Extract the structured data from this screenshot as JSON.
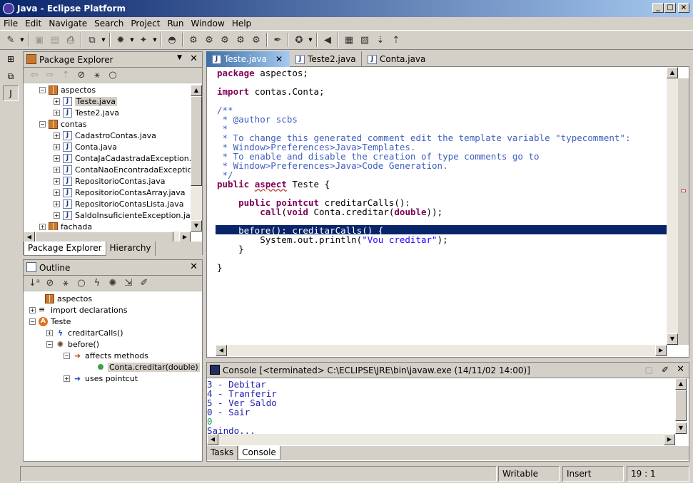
{
  "window": {
    "title": "Java - Eclipse Platform"
  },
  "menu": [
    "File",
    "Edit",
    "Navigate",
    "Search",
    "Project",
    "Run",
    "Window",
    "Help"
  ],
  "package_explorer": {
    "title": "Package Explorer",
    "tree": [
      {
        "label": "aspectos",
        "type": "package",
        "indent": 0,
        "exp": "−"
      },
      {
        "label": "Teste.java",
        "type": "java",
        "indent": 1,
        "exp": "+",
        "selected": true
      },
      {
        "label": "Teste2.java",
        "type": "java",
        "indent": 1,
        "exp": "+"
      },
      {
        "label": "contas",
        "type": "package",
        "indent": 0,
        "exp": "−"
      },
      {
        "label": "CadastroContas.java",
        "type": "java",
        "indent": 1,
        "exp": "+"
      },
      {
        "label": "Conta.java",
        "type": "java",
        "indent": 1,
        "exp": "+"
      },
      {
        "label": "ContaJaCadastradaException.java",
        "type": "java",
        "indent": 1,
        "exp": "+"
      },
      {
        "label": "ContaNaoEncontradaException.java",
        "type": "java",
        "indent": 1,
        "exp": "+"
      },
      {
        "label": "RepositorioContas.java",
        "type": "java",
        "indent": 1,
        "exp": "+"
      },
      {
        "label": "RepositorioContasArray.java",
        "type": "java",
        "indent": 1,
        "exp": "+"
      },
      {
        "label": "RepositorioContasLista.java",
        "type": "java",
        "indent": 1,
        "exp": "+"
      },
      {
        "label": "SaldoInsuficienteException.java",
        "type": "java",
        "indent": 1,
        "exp": "+"
      },
      {
        "label": "fachada",
        "type": "package",
        "indent": 0,
        "exp": "+"
      }
    ],
    "tabs": [
      "Package Explorer",
      "Hierarchy"
    ]
  },
  "outline": {
    "title": "Outline",
    "tree": [
      {
        "label": "aspectos",
        "indent": 0
      },
      {
        "label": "import declarations",
        "indent": 0
      },
      {
        "label": "Teste",
        "indent": 0
      },
      {
        "label": "creditarCalls()",
        "indent": 1
      },
      {
        "label": "before()",
        "indent": 1
      },
      {
        "label": "affects methods",
        "indent": 2
      },
      {
        "label": "Conta.creditar(double)",
        "indent": 3
      },
      {
        "label": "uses pointcut",
        "indent": 2
      }
    ]
  },
  "editor": {
    "tabs": [
      "Teste.java",
      "Teste2.java",
      "Conta.java"
    ],
    "lines": [
      [
        [
          "kw",
          "package"
        ],
        [
          "",
          "aspectos;"
        ]
      ],
      [],
      [
        [
          "kw",
          "import"
        ],
        [
          "",
          "contas.Conta;"
        ]
      ],
      [],
      [
        [
          "cm",
          "/**"
        ]
      ],
      [
        [
          "cm",
          " * @author scbs"
        ]
      ],
      [
        [
          "cm",
          " *"
        ]
      ],
      [
        [
          "cm",
          " * To change this generated comment edit the template variable \"typecomment\":"
        ]
      ],
      [
        [
          "cm",
          " * Window>Preferences>Java>Templates."
        ]
      ],
      [
        [
          "cm",
          " * To enable and disable the creation of type comments go to"
        ]
      ],
      [
        [
          "cm",
          " * Window>Preferences>Java>Code Generation."
        ]
      ],
      [
        [
          "cm",
          " */"
        ]
      ],
      [
        [
          "kw",
          "public"
        ],
        [
          "",
          "."
        ],
        [
          "kw",
          "aspect"
        ],
        [
          "",
          " Teste {"
        ]
      ],
      [],
      [
        [
          "",
          "    "
        ],
        [
          "kw",
          "public"
        ],
        [
          "",
          " "
        ],
        [
          "kw",
          "pointcut"
        ],
        [
          "",
          " creditarCalls():"
        ]
      ],
      [
        [
          "",
          "        "
        ],
        [
          "kw",
          "call"
        ],
        [
          "",
          "("
        ],
        [
          "kw",
          "void"
        ],
        [
          "",
          " Conta.creditar("
        ],
        [
          "kw",
          "double"
        ],
        [
          "",
          "));"
        ]
      ],
      [],
      [
        [
          "",
          "    before(): creditarCalls() {"
        ]
      ],
      [
        [
          "",
          "        System.out.println("
        ],
        [
          "str",
          "\"Vou creditar\""
        ],
        [
          "",
          ");"
        ]
      ],
      [
        [
          "",
          "    }"
        ]
      ],
      [],
      [
        [
          "",
          "}"
        ]
      ]
    ]
  },
  "console": {
    "title": "Console [<terminated> C:\\ECLIPSE\\JRE\\bin\\javaw.exe (14/11/02 14:00)]",
    "lines": [
      "3 - Debitar",
      "4 - Tranferir",
      "5 - Ver Saldo",
      "0 - Sair",
      "0",
      "Saindo..."
    ],
    "tabs": [
      "Tasks",
      "Console"
    ]
  },
  "status": {
    "mode": "Writable",
    "insert": "Insert",
    "position": "19 : 1"
  }
}
